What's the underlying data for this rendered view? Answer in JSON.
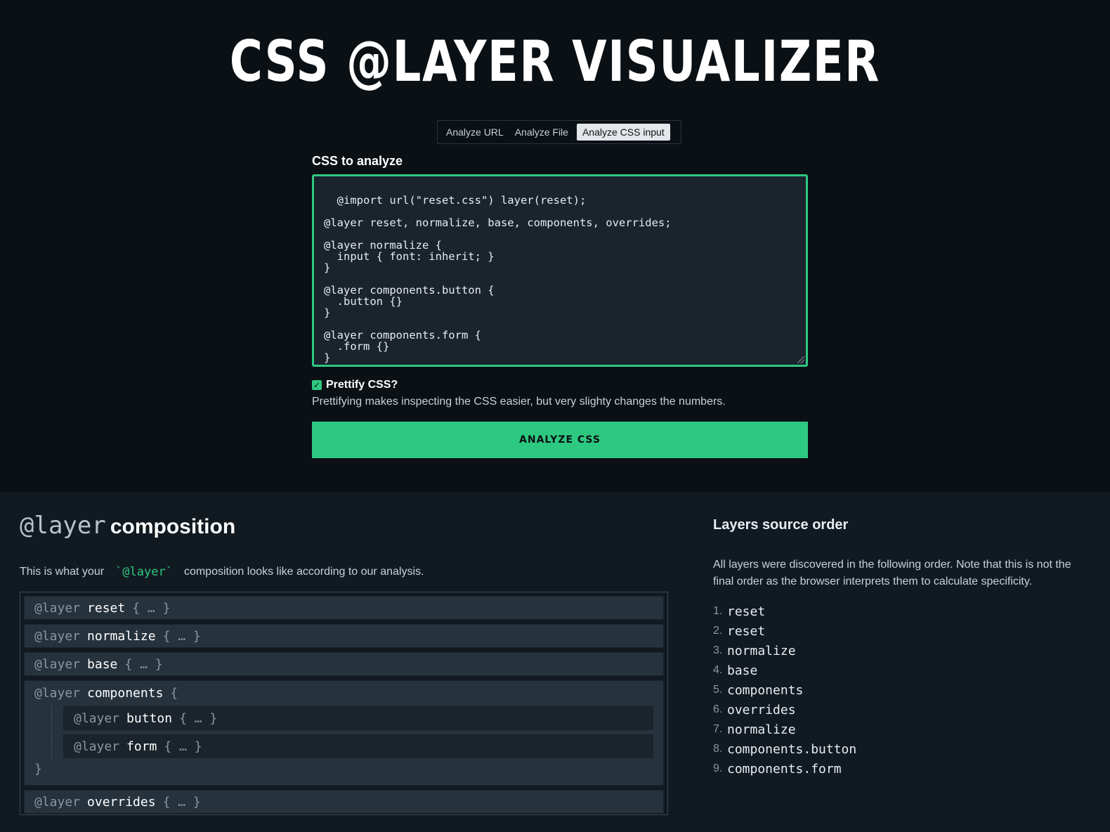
{
  "header": {
    "title": "CSS @LAYER VISUALIZER"
  },
  "tabs": [
    {
      "label": "Analyze URL",
      "active": false
    },
    {
      "label": "Analyze File",
      "active": false
    },
    {
      "label": "Analyze CSS input",
      "active": true
    }
  ],
  "form": {
    "css_label": "CSS to analyze",
    "css_value": "@import url(\"reset.css\") layer(reset);\n\n@layer reset, normalize, base, components, overrides;\n\n@layer normalize {\n  input { font: inherit; }\n}\n\n@layer components.button {\n  .button {}\n}\n\n@layer components.form {\n  .form {}\n}",
    "prettify_label": "Prettify CSS?",
    "prettify_checked": true,
    "prettify_help": "Prettifying makes inspecting the CSS easier, but very slighty changes the numbers.",
    "analyze_button": "ANALYZE CSS"
  },
  "composition": {
    "heading_code": "@layer",
    "heading_word": "composition",
    "desc_before": "This is what your",
    "desc_code": "`@layer`",
    "desc_after": "composition looks like according to our analysis.",
    "keyword": "@layer",
    "collapsed": "{ … }",
    "open_brace": "{",
    "close_brace": "}",
    "layers": [
      {
        "name": "reset"
      },
      {
        "name": "normalize"
      },
      {
        "name": "base"
      },
      {
        "name": "components",
        "children": [
          {
            "name": "button"
          },
          {
            "name": "form"
          }
        ]
      },
      {
        "name": "overrides"
      }
    ]
  },
  "source_order": {
    "heading": "Layers source order",
    "description": "All layers were discovered in the following order. Note that this is not the final order as the browser interprets them to calculate specificity.",
    "items": [
      {
        "num": "1.",
        "name": "reset"
      },
      {
        "num": "2.",
        "name": "reset"
      },
      {
        "num": "3.",
        "name": "normalize"
      },
      {
        "num": "4.",
        "name": "base"
      },
      {
        "num": "5.",
        "name": "components"
      },
      {
        "num": "6.",
        "name": "overrides"
      },
      {
        "num": "7.",
        "name": "normalize"
      },
      {
        "num": "8.",
        "name": "components.button"
      },
      {
        "num": "9.",
        "name": "components.form"
      }
    ]
  },
  "colors": {
    "accent": "#2ec981",
    "page_bg": "#0b1014",
    "section_bg": "#121a21"
  }
}
